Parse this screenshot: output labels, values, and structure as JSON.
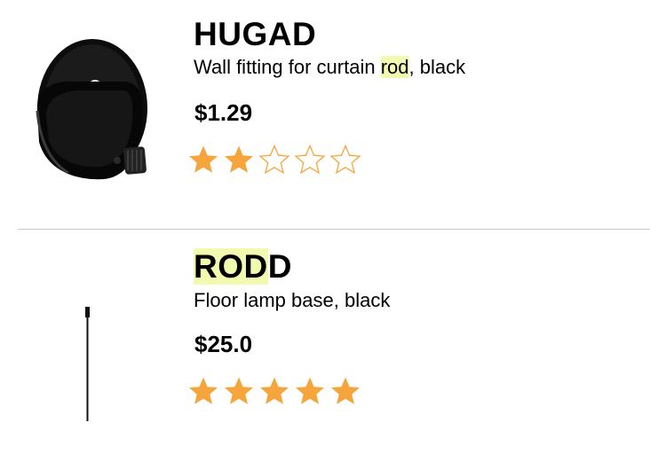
{
  "colors": {
    "star_fill": "#f5a53b",
    "highlight": "#f2fab0",
    "divider": "#c8c8c8"
  },
  "results": [
    {
      "icon": "wall-fitting-image",
      "title": {
        "pre": "",
        "hl": "",
        "post": "HUGAD"
      },
      "description": {
        "pre": "Wall fitting for curtain ",
        "hl": "rod",
        "post": ", black"
      },
      "price": "$1.29",
      "rating": {
        "value": 2,
        "max": 5
      }
    },
    {
      "icon": "floor-lamp-base-image",
      "title": {
        "pre": "",
        "hl": "ROD",
        "post": "D"
      },
      "description": {
        "pre": "Floor lamp base, black",
        "hl": "",
        "post": ""
      },
      "price": "$25.0",
      "rating": {
        "value": 5,
        "max": 5
      }
    }
  ]
}
